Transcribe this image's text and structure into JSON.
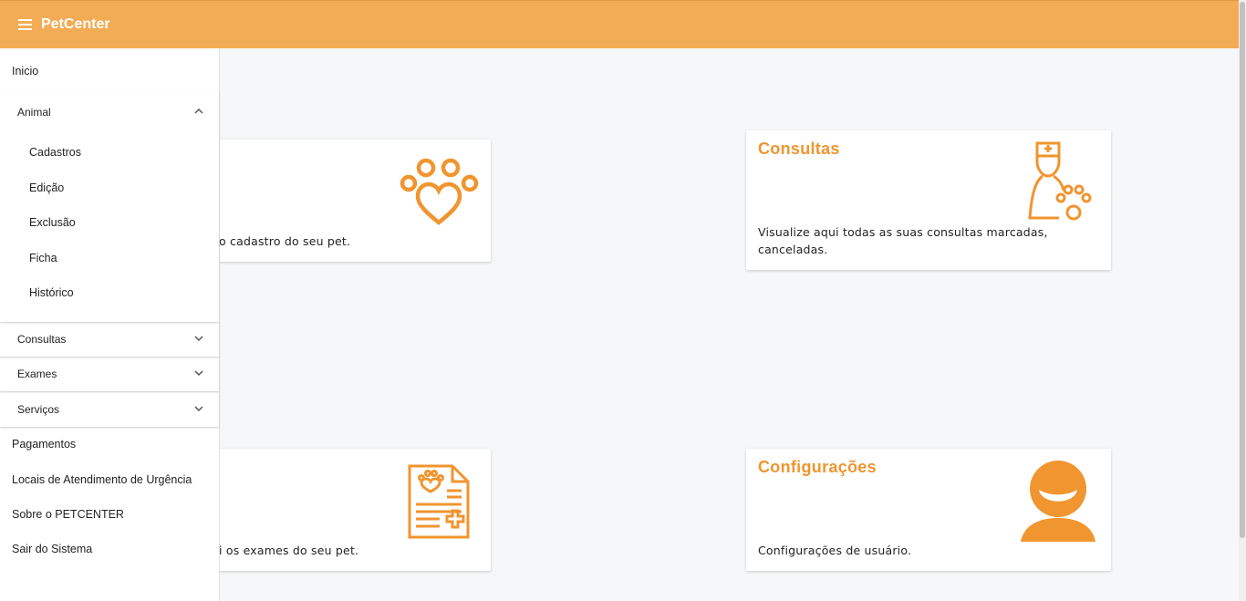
{
  "app": {
    "title": "PetCenter"
  },
  "icons": {
    "menu": "hamburger-menu-icon"
  },
  "colors": {
    "header": "#f2ac55",
    "accent": "#f0952f"
  },
  "cards": {
    "animal": {
      "text": "o cadastro do seu pet.",
      "icon": "paw-heart-icon"
    },
    "consultas": {
      "title": "Consultas",
      "text": "Visualize aqui todas as suas consultas marcadas, canceladas.",
      "icon": "veterinarian-paw-icon"
    },
    "exames": {
      "text": "i os exames do seu pet.",
      "icon": "pet-medical-record-icon"
    },
    "configuracoes": {
      "title": "Configurações",
      "text": "Configurações de usuário.",
      "icon": "user-avatar-icon"
    }
  },
  "sidebar": {
    "inicio": "Inicio",
    "animal": {
      "label": "Animal",
      "items": [
        "Cadastros",
        "Edição",
        "Exclusão",
        "Ficha",
        "Histórico"
      ]
    },
    "consultas": "Consultas",
    "exames": "Exames",
    "servicos": "Serviços",
    "pagamentos": "Pagamentos",
    "locais": "Locais de Atendimento de Urgência",
    "sobre": "Sobre o PETCENTER",
    "sair": "Sair do Sistema"
  }
}
